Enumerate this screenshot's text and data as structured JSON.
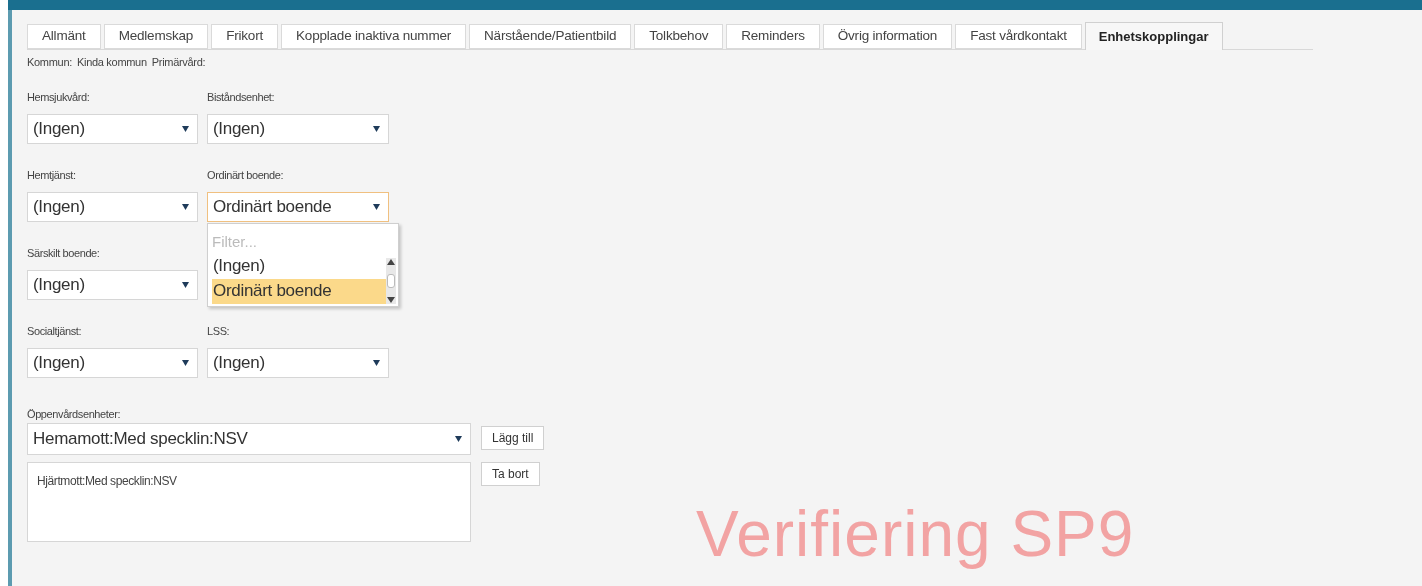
{
  "tabs": [
    {
      "label": "Allmänt",
      "selected": false
    },
    {
      "label": "Medlemskap",
      "selected": false
    },
    {
      "label": "Frikort",
      "selected": false
    },
    {
      "label": "Kopplade inaktiva nummer",
      "selected": false
    },
    {
      "label": "Närstående/Patientbild",
      "selected": false
    },
    {
      "label": "Tolkbehov",
      "selected": false
    },
    {
      "label": "Reminders",
      "selected": false
    },
    {
      "label": "Övrig information",
      "selected": false
    },
    {
      "label": "Fast vårdkontakt",
      "selected": false
    },
    {
      "label": "Enhetskopplingar",
      "selected": true
    }
  ],
  "info_line": [
    "Kommun:",
    "Kinda kommun",
    "Primärvård:"
  ],
  "field_rows": [
    [
      {
        "label": "Hemsjukvård:",
        "value": "(Ingen)",
        "focused": false
      },
      {
        "label": "Biståndsenhet:",
        "value": "(Ingen)",
        "focused": false
      }
    ],
    [
      {
        "label": "Hemtjänst:",
        "value": "(Ingen)",
        "focused": false
      },
      {
        "label": "Ordinärt boende:",
        "value": "Ordinärt boende",
        "focused": true,
        "open": true
      }
    ],
    [
      {
        "label": "Särskilt boende:",
        "value": "(Ingen)",
        "focused": false
      }
    ],
    [
      {
        "label": "Socialtjänst:",
        "value": "(Ingen)",
        "focused": false
      },
      {
        "label": "LSS:",
        "value": "(Ingen)",
        "focused": false
      }
    ]
  ],
  "dropdown": {
    "filter_placeholder": "Filter...",
    "options": [
      {
        "label": "(Ingen)",
        "selected": false
      },
      {
        "label": "Ordinärt boende",
        "selected": true
      }
    ]
  },
  "oppenvard": {
    "label": "Öppenvårdsenheter:",
    "value": "Hemamott:Med specklin:NSV",
    "add_button": "Lägg till",
    "items": [
      "Hjärtmott:Med specklin:NSV"
    ],
    "remove_button": "Ta bort"
  },
  "stamp": "Verifiering SP9"
}
